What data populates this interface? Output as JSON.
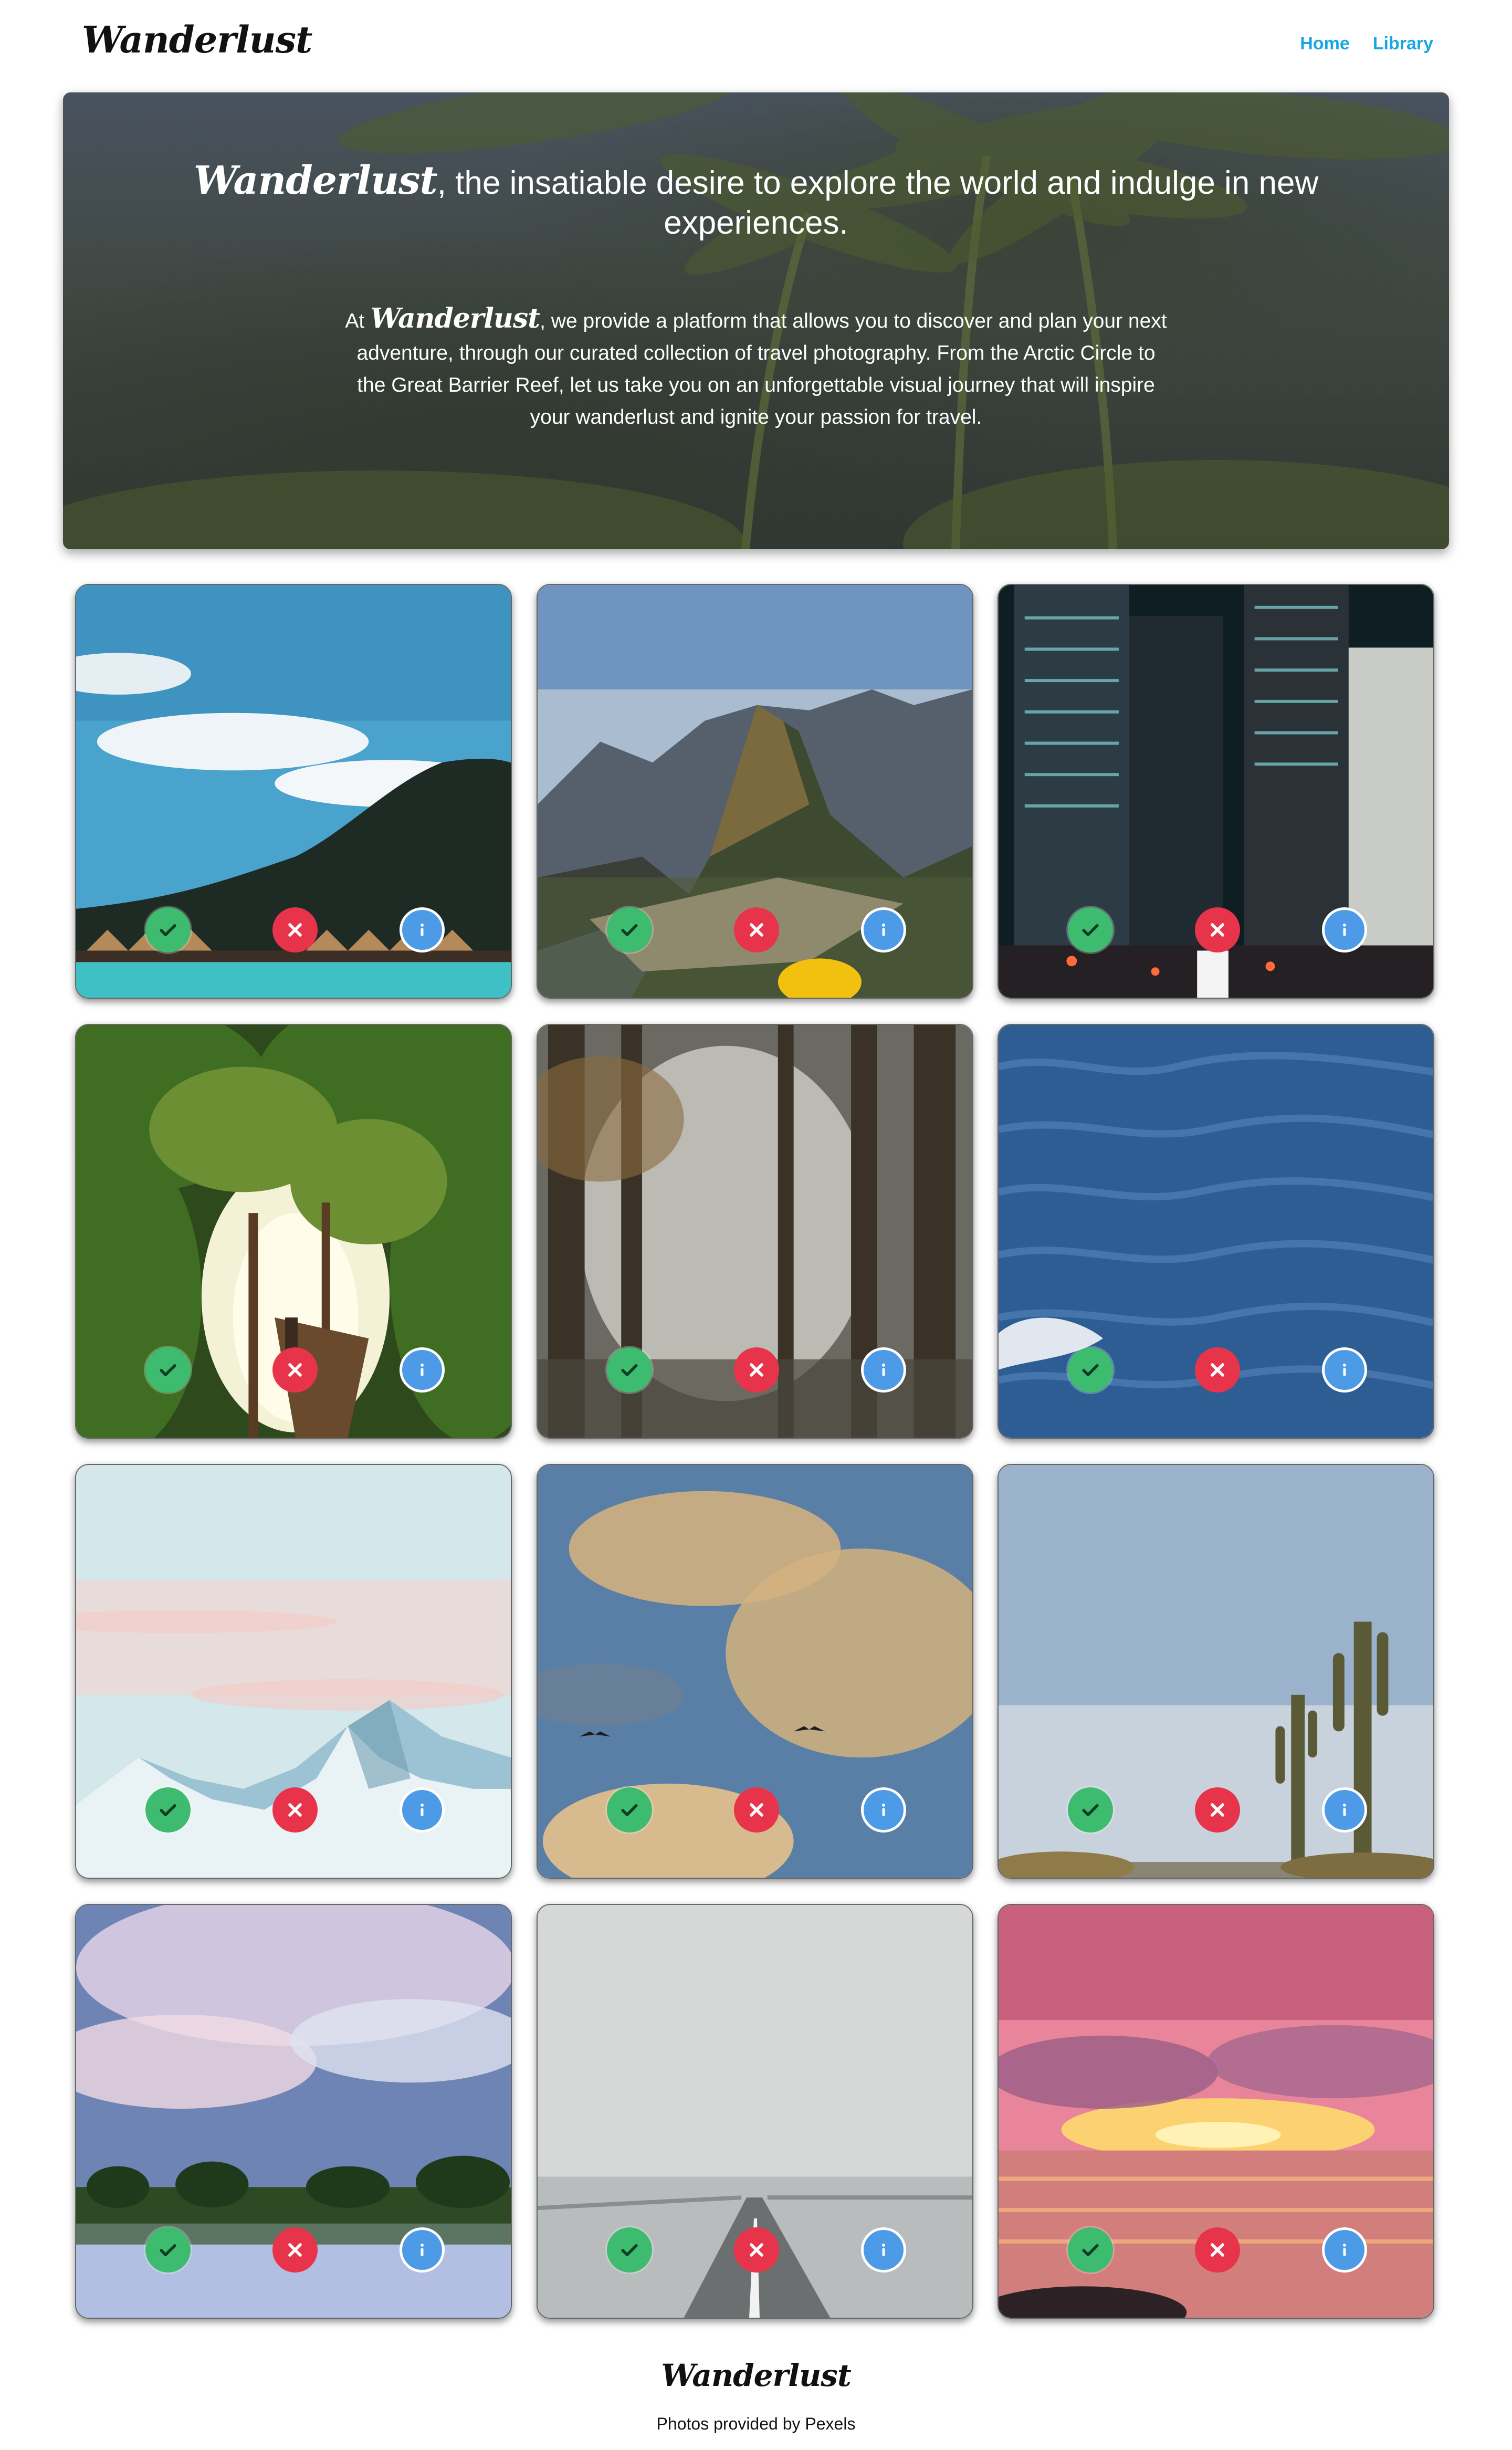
{
  "header": {
    "logo": "Wanderlust",
    "nav": [
      {
        "label": "Home"
      },
      {
        "label": "Library"
      }
    ]
  },
  "hero": {
    "brand": "Wanderlust",
    "title_rest": ", the insatiable desire to explore the world and indulge in new experiences.",
    "text_prefix": "At ",
    "text_brand": "Wanderlust",
    "text_rest": ", we provide a platform that allows you to discover and plan your next adventure, through our curated collection of travel photography. From the Arctic Circle to the Great Barrier Reef, let us take you on an unforgettable visual journey that will inspire your wanderlust and ignite your passion for travel."
  },
  "gallery": {
    "photos": [
      {
        "subject": "tropical-bay-overwater-bungalows"
      },
      {
        "subject": "machu-picchu-mountain"
      },
      {
        "subject": "city-skyscrapers-night"
      },
      {
        "subject": "jungle-treehouse"
      },
      {
        "subject": "misty-forest-sunrays"
      },
      {
        "subject": "ocean-waves"
      },
      {
        "subject": "snowy-mountains-pastel-sky"
      },
      {
        "subject": "clouds-with-birds"
      },
      {
        "subject": "desert-cactus"
      },
      {
        "subject": "lake-reflection-trees"
      },
      {
        "subject": "foggy-bridge-road"
      },
      {
        "subject": "ocean-sunset"
      }
    ],
    "actions": {
      "accept_icon": "check-icon",
      "reject_icon": "x-icon",
      "info_icon": "info-icon",
      "accept_color": "#3dbb6f",
      "reject_color": "#e8344a",
      "info_color": "#4d9be6"
    }
  },
  "footer": {
    "logo": "Wanderlust",
    "credit": "Photos provided by Pexels"
  },
  "colors": {
    "nav_link": "#1aa6e0",
    "background": "#ffffff"
  }
}
